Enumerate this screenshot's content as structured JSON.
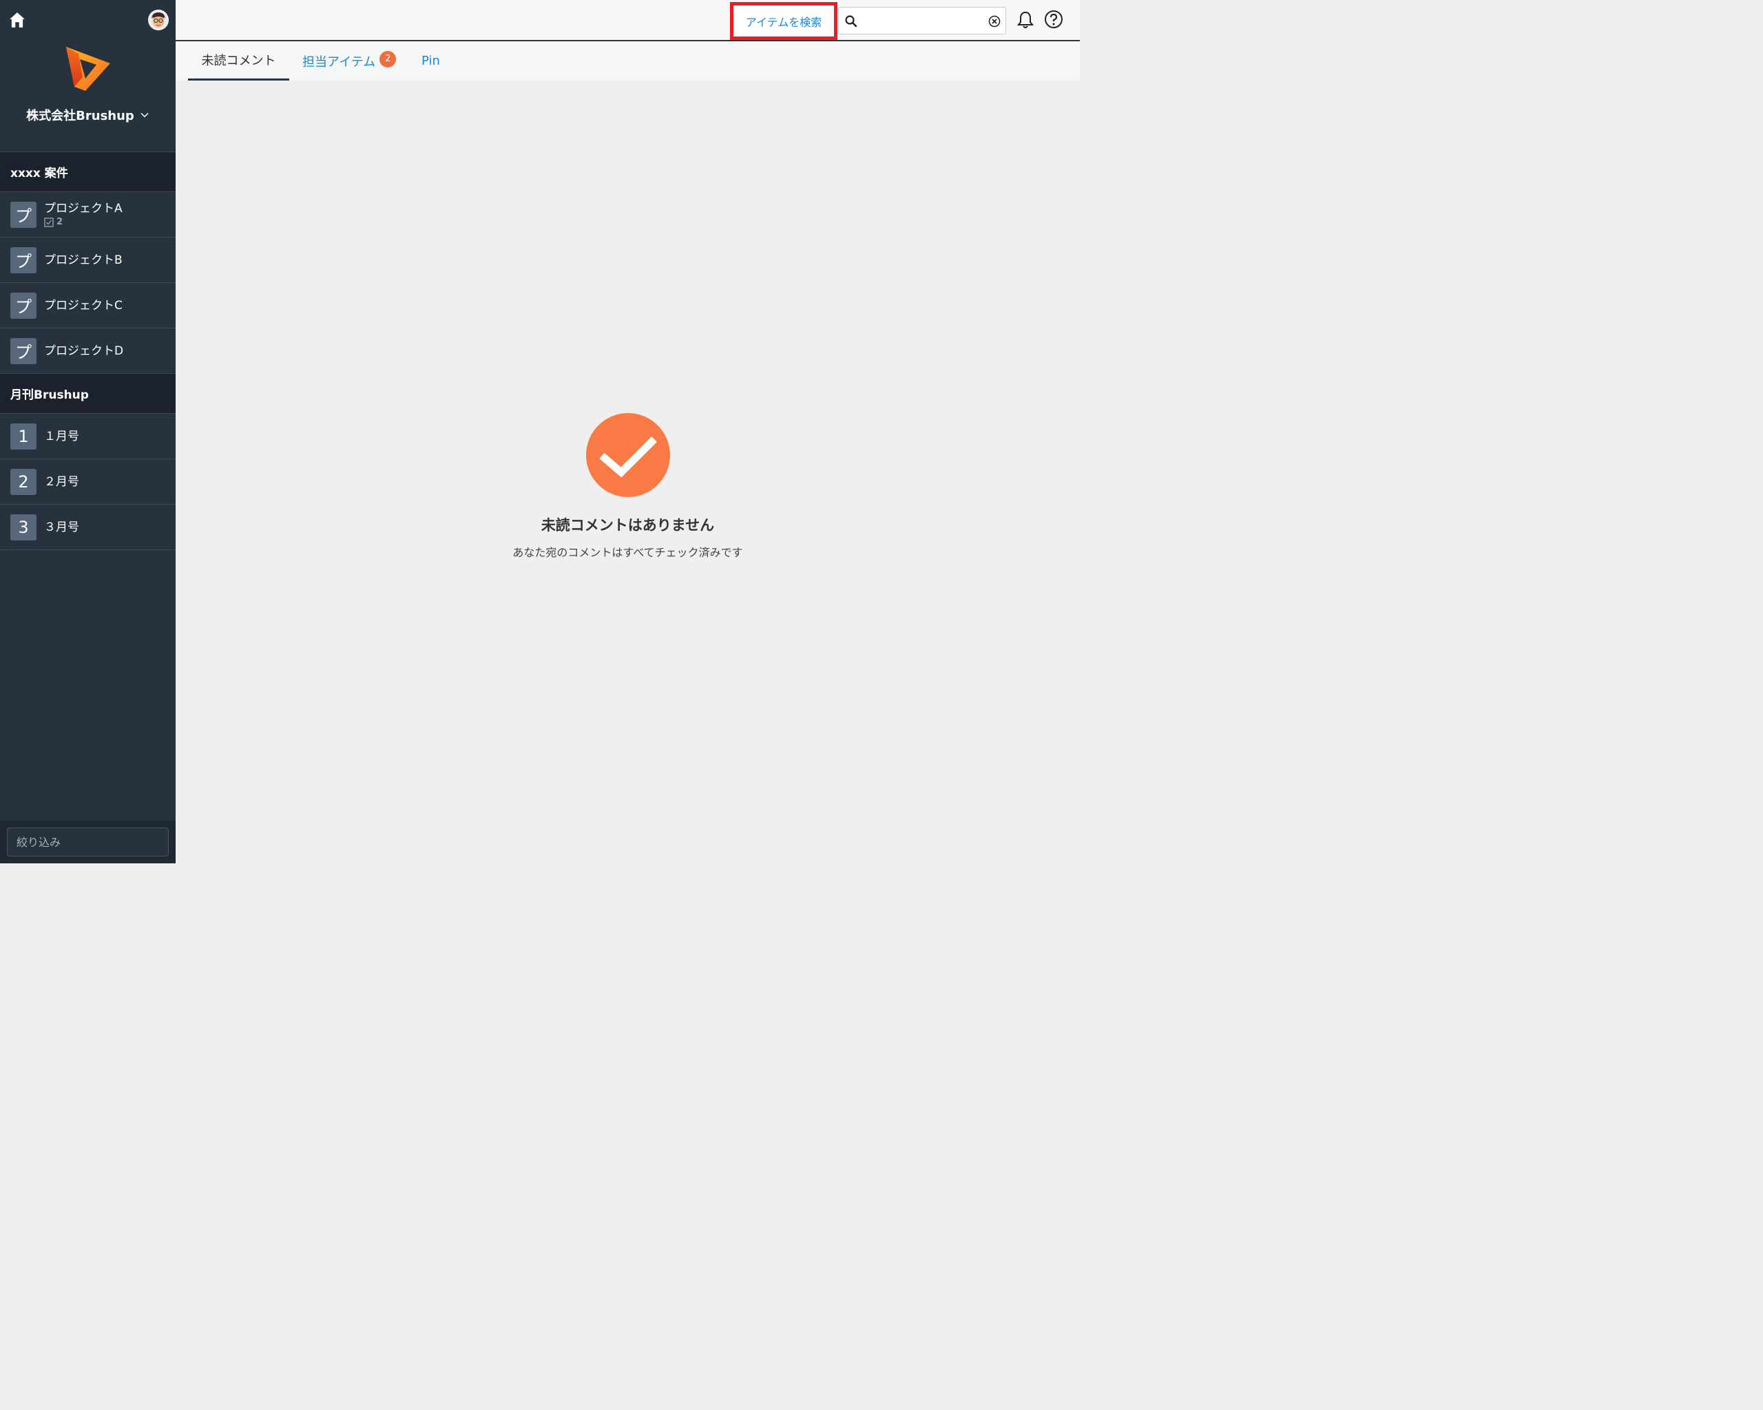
{
  "sidebar": {
    "org_name": "株式会社Brushup",
    "groups": [
      {
        "title": "xxxx 案件",
        "items": [
          {
            "initial": "プ",
            "label": "プロジェクトA",
            "count": "2"
          },
          {
            "initial": "プ",
            "label": "プロジェクトB"
          },
          {
            "initial": "プ",
            "label": "プロジェクトC"
          },
          {
            "initial": "プ",
            "label": "プロジェクトD"
          }
        ]
      },
      {
        "title": "月刊Brushup",
        "items": [
          {
            "initial": "1",
            "label": "１月号"
          },
          {
            "initial": "2",
            "label": "２月号"
          },
          {
            "initial": "3",
            "label": "３月号"
          }
        ]
      }
    ],
    "filter_placeholder": "絞り込み"
  },
  "topbar": {
    "search_scope_label": "アイテムを検索",
    "search_value": ""
  },
  "tabs": [
    {
      "label": "未読コメント"
    },
    {
      "label": "担当アイテム",
      "badge": "2"
    },
    {
      "label": "Pin"
    }
  ],
  "empty_state": {
    "title": "未読コメントはありません",
    "subtitle": "あなた宛のコメントはすべてチェック済みです"
  },
  "colors": {
    "sidebar_bg": "#27323f",
    "group_header_bg": "#1c222b",
    "accent_orange": "#f36c3b",
    "link_blue": "#1a8ad6",
    "highlight_red": "#ee1c25"
  },
  "icons": [
    "home-icon",
    "avatar",
    "brushup-logo",
    "chevron-down-icon",
    "checkbox-icon",
    "search-icon",
    "clear-icon",
    "bell-icon",
    "help-icon",
    "check-circle-icon"
  ]
}
